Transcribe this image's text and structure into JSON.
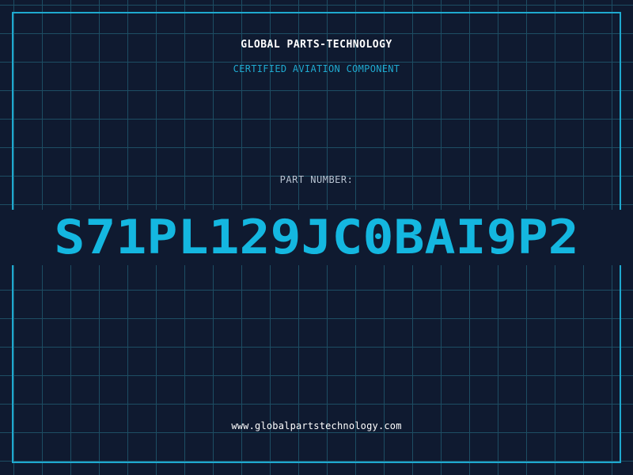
{
  "label": {
    "brand": "GLOBAL PARTS-TECHNOLOGY",
    "tagline": "CERTIFIED AVIATION COMPONENT",
    "part_number_label": "PART NUMBER:",
    "part_number": "S71PL129JC0BAI9P2",
    "website": "www.globalpartstechnology.com"
  },
  "colors": {
    "background": "#0f1a30",
    "grid": "#1d4d63",
    "accent": "#1fa9cf",
    "part_number": "#14b7e0",
    "text": "#ffffff"
  }
}
